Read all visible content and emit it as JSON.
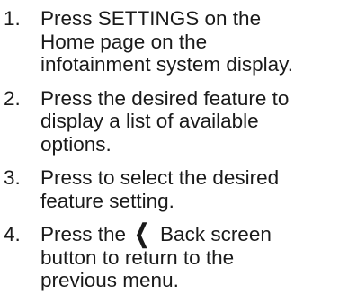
{
  "steps": [
    {
      "number": "1.",
      "text": "Press SETTINGS on the Home page on the infotainment system display."
    },
    {
      "number": "2.",
      "text": "Press the desired feature to display a list of available options."
    },
    {
      "number": "3.",
      "text": "Press to select the desired feature setting."
    },
    {
      "number": "4.",
      "text_before": "Press the",
      "icon": "back-chevron-icon",
      "text_after": "Back screen button to return to the previous menu."
    }
  ]
}
